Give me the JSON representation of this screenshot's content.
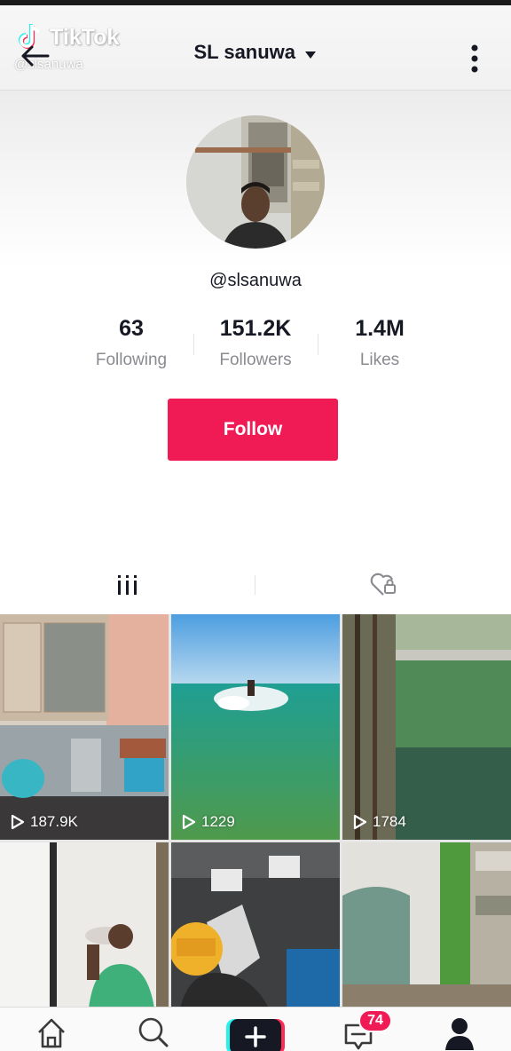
{
  "watermark": {
    "brand": "TikTok",
    "handle": "@slsanuwa"
  },
  "header": {
    "title": "SL sanuwa"
  },
  "profile": {
    "handle": "@slsanuwa"
  },
  "stats": [
    {
      "value": "63",
      "label": "Following"
    },
    {
      "value": "151.2K",
      "label": "Followers"
    },
    {
      "value": "1.4M",
      "label": "Likes"
    }
  ],
  "actions": {
    "follow_label": "Follow"
  },
  "videos": [
    {
      "views": "187.9K"
    },
    {
      "views": "1229"
    },
    {
      "views": "1784"
    },
    {
      "views": ""
    },
    {
      "views": ""
    },
    {
      "views": ""
    }
  ],
  "nav": {
    "inbox_badge": "74"
  },
  "colors": {
    "accent": "#f01a55",
    "text": "#161823",
    "muted": "#8a8b91"
  }
}
